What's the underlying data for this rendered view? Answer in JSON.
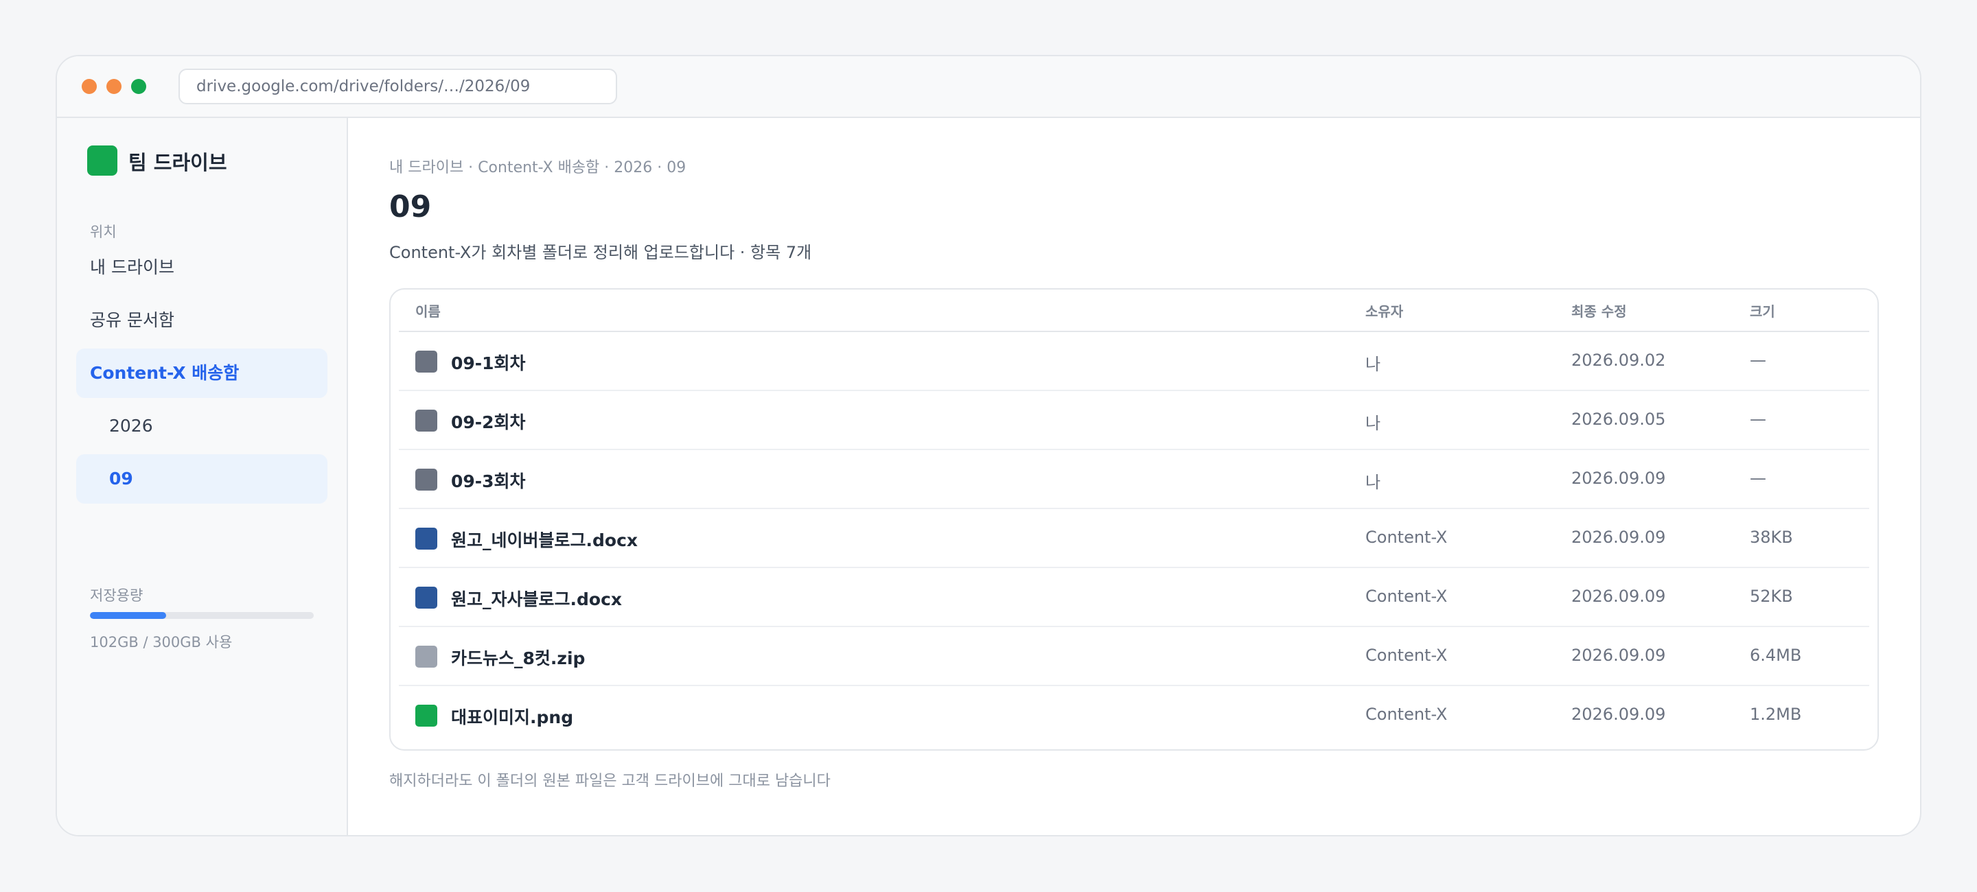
{
  "browser": {
    "url": "drive.google.com/drive/folders/…/2026/09"
  },
  "sidebar": {
    "brand": "팀 드라이브",
    "brand_color": "#14a84f",
    "section_label": "위치",
    "items": [
      {
        "label": "내 드라이브",
        "active": false
      },
      {
        "label": "공유 문서함",
        "active": false
      },
      {
        "label": "Content-X 배송함",
        "active": true
      },
      {
        "label": "2026",
        "active": false
      },
      {
        "label": "09",
        "active": true
      }
    ],
    "storage": {
      "label": "저장용량",
      "used_fraction": 0.34,
      "text": "102GB / 300GB 사용"
    }
  },
  "main": {
    "breadcrumb": "내 드라이브 · Content-X 배송함 · 2026 · 09",
    "title": "09",
    "subtitle": "Content-X가 회차별 폴더로 정리해 업로드합니다 · 항목 7개",
    "table": {
      "columns": [
        "이름",
        "소유자",
        "최종 수정",
        "크기"
      ],
      "rows": [
        {
          "icon": "folder-icon",
          "icon_color": "#6b7280",
          "name": "09-1회차",
          "owner": "나",
          "modified": "2026.09.02",
          "size": "—"
        },
        {
          "icon": "folder-icon",
          "icon_color": "#6b7280",
          "name": "09-2회차",
          "owner": "나",
          "modified": "2026.09.05",
          "size": "—"
        },
        {
          "icon": "folder-icon",
          "icon_color": "#6b7280",
          "name": "09-3회차",
          "owner": "나",
          "modified": "2026.09.09",
          "size": "—"
        },
        {
          "icon": "doc-icon",
          "icon_color": "#2b579a",
          "name": "원고_네이버블로그.docx",
          "owner": "Content-X",
          "modified": "2026.09.09",
          "size": "38KB"
        },
        {
          "icon": "doc-icon",
          "icon_color": "#2b579a",
          "name": "원고_자사블로그.docx",
          "owner": "Content-X",
          "modified": "2026.09.09",
          "size": "52KB"
        },
        {
          "icon": "zip-icon",
          "icon_color": "#9ca3af",
          "name": "카드뉴스_8컷.zip",
          "owner": "Content-X",
          "modified": "2026.09.09",
          "size": "6.4MB"
        },
        {
          "icon": "image-icon",
          "icon_color": "#14a84f",
          "name": "대표이미지.png",
          "owner": "Content-X",
          "modified": "2026.09.09",
          "size": "1.2MB"
        }
      ]
    },
    "footnote": "해지하더라도 이 폴더의 원본 파일은 고객 드라이브에 그대로 남습니다"
  }
}
